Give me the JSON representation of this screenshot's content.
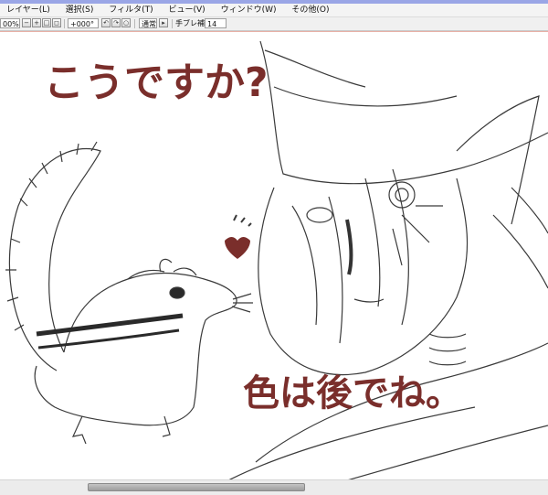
{
  "menu": {
    "items": [
      "レイヤー(L)",
      "選択(S)",
      "フィルタ(T)",
      "ビュー(V)",
      "ウィンドウ(W)",
      "その他(O)"
    ]
  },
  "toolbar": {
    "zoom": "00%",
    "rotation": "+000°",
    "blend_mode": "通常",
    "stabilizer_label": "手ブレ補正",
    "stabilizer_value": "14"
  },
  "canvas": {
    "text_top": "こうですか?",
    "text_bottom": "色は後でね。"
  },
  "colors": {
    "ink": "#7a2e2b",
    "sketch": "#3a3a3a",
    "accent": "#9aa6e6"
  }
}
